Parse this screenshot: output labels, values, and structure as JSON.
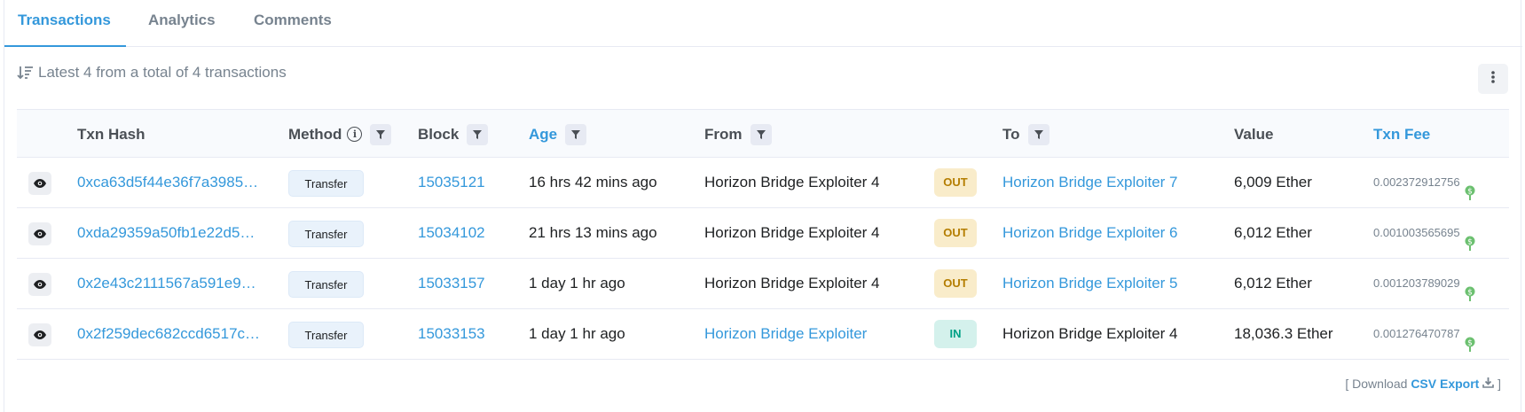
{
  "tabs": [
    {
      "label": "Transactions",
      "active": true
    },
    {
      "label": "Analytics",
      "active": false
    },
    {
      "label": "Comments",
      "active": false
    }
  ],
  "summary": "Latest 4 from a total of 4 transactions",
  "columns": {
    "hash": "Txn Hash",
    "method": "Method",
    "block": "Block",
    "age": "Age",
    "from": "From",
    "to": "To",
    "value": "Value",
    "fee": "Txn Fee"
  },
  "rows": [
    {
      "hash": "0xca63d5f44e36f7a3985…",
      "method": "Transfer",
      "block": "15035121",
      "age": "16 hrs 42 mins ago",
      "from": "Horizon Bridge Exploiter 4",
      "direction": "OUT",
      "to": "Horizon Bridge Exploiter 7",
      "value": "6,009 Ether",
      "fee": "0.002372912756"
    },
    {
      "hash": "0xda29359a50fb1e22d5…",
      "method": "Transfer",
      "block": "15034102",
      "age": "21 hrs 13 mins ago",
      "from": "Horizon Bridge Exploiter 4",
      "direction": "OUT",
      "to": "Horizon Bridge Exploiter 6",
      "value": "6,012 Ether",
      "fee": "0.001003565695"
    },
    {
      "hash": "0x2e43c2111567a591e9…",
      "method": "Transfer",
      "block": "15033157",
      "age": "1 day 1 hr ago",
      "from": "Horizon Bridge Exploiter 4",
      "direction": "OUT",
      "to": "Horizon Bridge Exploiter 5",
      "value": "6,012 Ether",
      "fee": "0.001203789029"
    },
    {
      "hash": "0x2f259dec682ccd6517c…",
      "method": "Transfer",
      "block": "15033153",
      "age": "1 day 1 hr ago",
      "from": "Horizon Bridge Exploiter",
      "direction": "IN",
      "to": "Horizon Bridge Exploiter 4",
      "value": "18,036.3 Ether",
      "fee": "0.001276470787"
    }
  ],
  "download": {
    "prefix": "[ Download",
    "csv": "CSV Export",
    "suffix": "]"
  },
  "colors": {
    "accent": "#3498db",
    "out_bg": "#f9ecca",
    "in_bg": "#d4f1ec"
  }
}
